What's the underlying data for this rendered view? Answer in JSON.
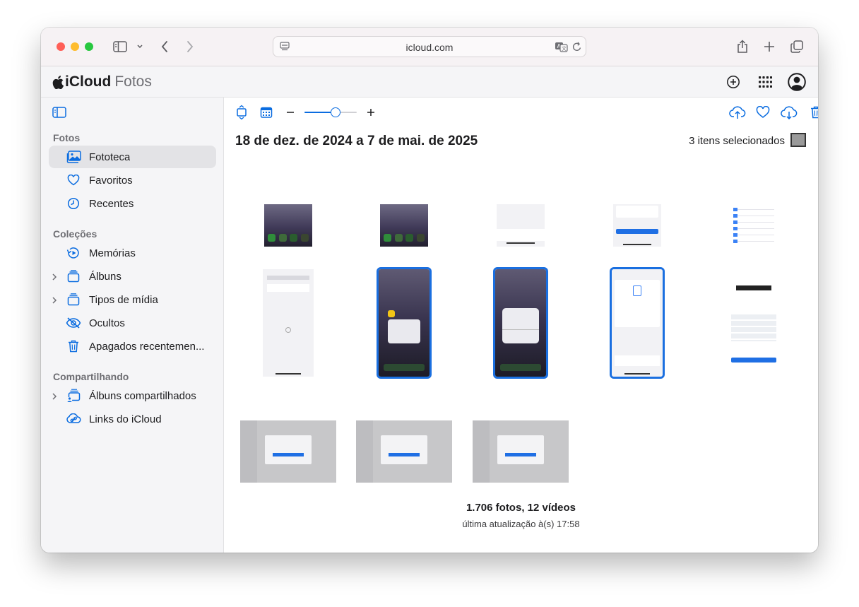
{
  "browser": {
    "url": "icloud.com",
    "icons": [
      "sidebar-toggle-icon",
      "chevron-down-icon",
      "back-icon",
      "forward-icon",
      "page-menu-icon",
      "translate-icon",
      "reload-icon",
      "share-icon",
      "new-tab-icon",
      "tabs-overview-icon"
    ]
  },
  "app": {
    "brand": "iCloud",
    "section": "Fotos",
    "header_icons": [
      "add-icon",
      "app-grid-icon",
      "account-icon"
    ]
  },
  "sidebar": {
    "sections": [
      {
        "title": "Fotos",
        "items": [
          {
            "label": "Fototeca",
            "icon": "library-icon",
            "active": true
          },
          {
            "label": "Favoritos",
            "icon": "heart-icon"
          },
          {
            "label": "Recentes",
            "icon": "clock-icon"
          }
        ]
      },
      {
        "title": "Coleções",
        "items": [
          {
            "label": "Memórias",
            "icon": "memories-icon"
          },
          {
            "label": "Álbuns",
            "icon": "albums-icon",
            "expandable": true
          },
          {
            "label": "Tipos de mídia",
            "icon": "media-types-icon",
            "expandable": true
          },
          {
            "label": "Ocultos",
            "icon": "hidden-icon"
          },
          {
            "label": "Apagados recentemen...",
            "icon": "trash-icon"
          }
        ]
      },
      {
        "title": "Compartilhando",
        "items": [
          {
            "label": "Álbuns compartilhados",
            "icon": "shared-albums-icon",
            "expandable": true
          },
          {
            "label": "Links do iCloud",
            "icon": "link-icon"
          }
        ]
      }
    ]
  },
  "toolbar": {
    "left_icons": [
      "aspect-toggle-icon",
      "calendar-view-icon",
      "zoom-out-icon",
      "zoom-slider",
      "zoom-in-icon"
    ],
    "right_icons": [
      "upload-icon",
      "favorite-icon",
      "download-icon",
      "delete-icon",
      "more-icon"
    ],
    "zoom_level": 0.6
  },
  "main": {
    "date_range": "18 de dez. de 2024 a 7 de mai. de 2025",
    "selection_text": "3 itens selecionados",
    "footer_count": "1.706 fotos, 12 vídeos",
    "footer_updated": "última atualização à(s) 17:58"
  },
  "photos": [
    {
      "kind": "dark-phone",
      "selected": false
    },
    {
      "kind": "dark-phone",
      "selected": false
    },
    {
      "kind": "light-sheet",
      "selected": false
    },
    {
      "kind": "light-settings-button",
      "selected": false
    },
    {
      "kind": "light-settings-list",
      "selected": false
    },
    {
      "kind": "light-update",
      "selected": false
    },
    {
      "kind": "dark-phone-menu",
      "selected": true
    },
    {
      "kind": "dark-phone-alert",
      "selected": true
    },
    {
      "kind": "light-transfer",
      "selected": true
    },
    {
      "kind": "light-erase",
      "selected": false
    },
    {
      "kind": "mac-dialog",
      "selected": false
    },
    {
      "kind": "mac-dialog",
      "selected": false
    },
    {
      "kind": "mac-dialog",
      "selected": false
    }
  ],
  "colors": {
    "accent": "#0a6ce0",
    "selection": "#1a6fe0",
    "sidebar_bg": "#f5f5f7",
    "close": "#ff5f57",
    "minimize": "#febc2e",
    "zoom": "#28c840"
  }
}
